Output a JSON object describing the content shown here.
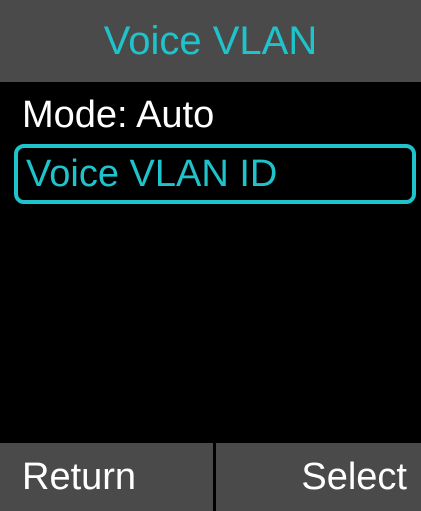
{
  "header": {
    "title": "Voice VLAN"
  },
  "menu": {
    "items": [
      {
        "label": "Mode: Auto"
      },
      {
        "label": "Voice VLAN ID"
      }
    ],
    "selected_index": 1
  },
  "softkeys": {
    "left": "Return",
    "right": "Select"
  },
  "colors": {
    "accent": "#1fc3cb",
    "bar": "#4a4a4a",
    "background": "#000000",
    "text": "#ffffff"
  }
}
